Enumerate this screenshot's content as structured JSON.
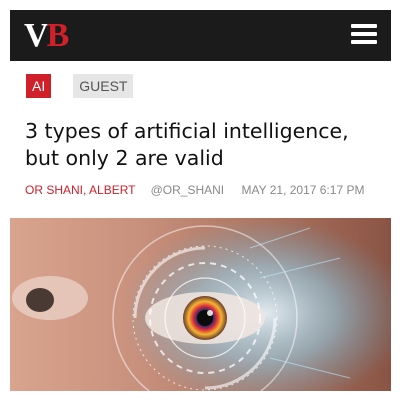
{
  "brand": {
    "logo_v": "V",
    "logo_b": "B"
  },
  "header": {
    "menu_icon": "hamburger-menu-icon"
  },
  "tags": {
    "primary": "AI",
    "secondary": "GUEST"
  },
  "article": {
    "title": "3 types of artificial intelligence, but only 2 are valid",
    "author": "OR SHANI, ALBERT",
    "handle": "@OR_SHANI",
    "date": "MAY 21, 2017 6:17 PM"
  },
  "colors": {
    "brand_red": "#d0202a",
    "topbar": "#1b1b1b"
  }
}
